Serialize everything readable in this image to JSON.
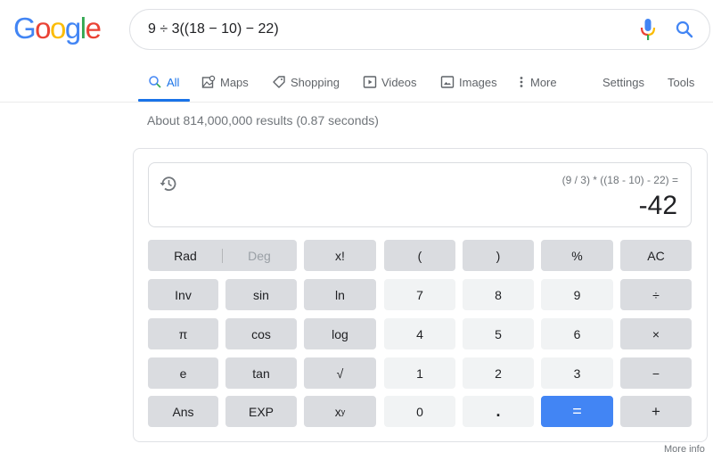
{
  "logo": {
    "letters": [
      {
        "char": "G",
        "color": "#4285f4"
      },
      {
        "char": "o",
        "color": "#ea4335"
      },
      {
        "char": "o",
        "color": "#fbbc05"
      },
      {
        "char": "g",
        "color": "#4285f4"
      },
      {
        "char": "l",
        "color": "#34a853"
      },
      {
        "char": "e",
        "color": "#ea4335"
      }
    ]
  },
  "search": {
    "value": "9 ÷ 3((18 − 10) − 22)",
    "mic_icon": "microphone-icon",
    "search_icon": "search-icon"
  },
  "tabs": {
    "items": [
      {
        "label": "All",
        "icon": "search-icon",
        "active": true
      },
      {
        "label": "Maps",
        "icon": "map-icon"
      },
      {
        "label": "Shopping",
        "icon": "tag-icon"
      },
      {
        "label": "Videos",
        "icon": "play-icon"
      },
      {
        "label": "Images",
        "icon": "image-icon"
      },
      {
        "label": "More",
        "icon": "more-vert-icon"
      }
    ],
    "settings": "Settings",
    "tools": "Tools"
  },
  "results_stats": "About 814,000,000 results (0.87 seconds)",
  "calculator": {
    "expression": "(9 / 3) * ((18 - 10) - 22) =",
    "result": "-42",
    "rad_label": "Rad",
    "deg_label": "Deg",
    "buttons": {
      "fact": "x!",
      "lparen": "(",
      "rparen": ")",
      "percent": "%",
      "ac": "AC",
      "inv": "Inv",
      "sin": "sin",
      "ln": "ln",
      "n7": "7",
      "n8": "8",
      "n9": "9",
      "div": "÷",
      "pi": "π",
      "cos": "cos",
      "log": "log",
      "n4": "4",
      "n5": "5",
      "n6": "6",
      "mul": "×",
      "e": "e",
      "tan": "tan",
      "sqrt": "√",
      "n1": "1",
      "n2": "2",
      "n3": "3",
      "sub": "−",
      "ans": "Ans",
      "exp": "EXP",
      "pow_base": "x",
      "pow_exp": "y",
      "n0": "0",
      "dot": ".",
      "eq": "=",
      "add": "+"
    },
    "accent_color": "#4285f4"
  },
  "more_info": "More info"
}
